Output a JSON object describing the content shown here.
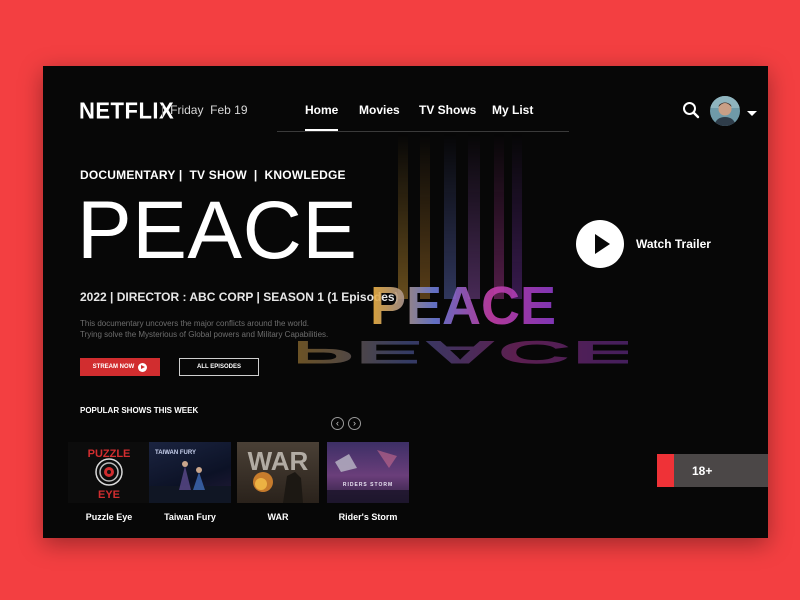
{
  "header": {
    "logo": "NETFLIX",
    "separator": "|",
    "date": "Friday  Feb 19",
    "nav": [
      {
        "label": "Home",
        "active": true
      },
      {
        "label": "Movies",
        "active": false
      },
      {
        "label": "TV Shows",
        "active": false
      },
      {
        "label": "My List",
        "active": false
      }
    ]
  },
  "hero": {
    "genres": "DOCUMENTARY |  TV SHOW  |  KNOWLEDGE",
    "title": "PEACE",
    "meta": "2022 | DIRECTOR : ABC CORP | SEASON 1 (1 Episodes)",
    "description_line1": "This documentary uncovers the major conflicts around the world.",
    "description_line2": "Trying solve the Mysterious of Global powers and Military Capabilities.",
    "stream_label": "STREAM NOW",
    "episodes_label": "ALL EPISODES",
    "art_text": "PEACE",
    "trailer_label": "Watch Trailer"
  },
  "popular": {
    "title": "POPULAR SHOWS THIS WEEK",
    "shows": [
      {
        "title": "Puzzle Eye",
        "art_text_1": "PUZZLE",
        "art_text_2": "EYE"
      },
      {
        "title": "Taiwan Fury",
        "art_text_1": "TAIWAN FURY"
      },
      {
        "title": "WAR",
        "art_text_1": "WAR"
      },
      {
        "title": "Rider's Storm",
        "art_text_1": "RIDERS STORM"
      }
    ]
  },
  "rating": {
    "label": "18+"
  },
  "colors": {
    "page_background": "#f33f41",
    "window_background": "#070707",
    "accent_red": "#d12d2f",
    "rating_background": "#4b4747"
  },
  "icons": [
    "search-icon",
    "caret-down-icon",
    "play-icon",
    "chevron-left-icon",
    "chevron-right-icon"
  ]
}
